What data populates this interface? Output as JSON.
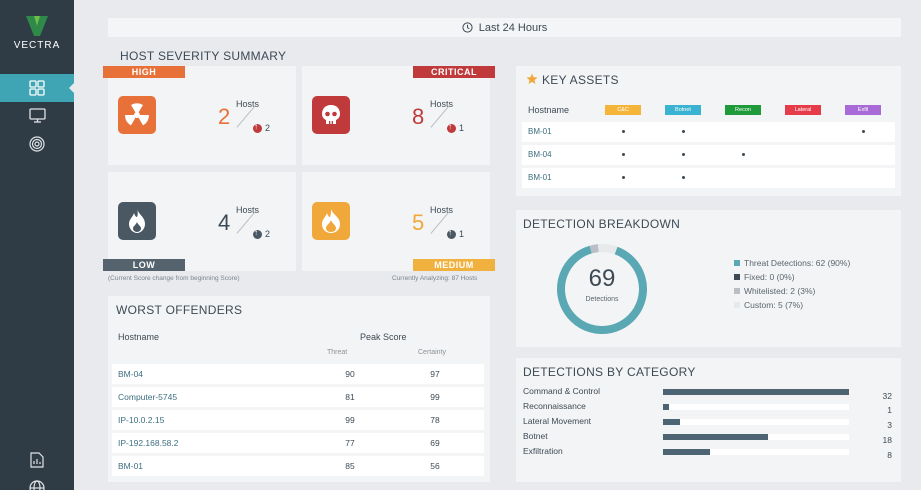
{
  "brand": {
    "name": "VECTRA"
  },
  "sidebar": {
    "items": [
      {
        "icon": "dashboard-grid-icon",
        "active": true
      },
      {
        "icon": "monitor-icon",
        "active": false
      },
      {
        "icon": "target-icon",
        "active": false
      }
    ],
    "bottom": [
      {
        "icon": "report-icon"
      },
      {
        "icon": "globe-icon"
      }
    ]
  },
  "timebar": {
    "label": "Last 24 Hours",
    "icon": "clock-icon"
  },
  "host_severity": {
    "title": "HOST SEVERITY SUMMARY",
    "cards": {
      "high": {
        "label": "HIGH",
        "count": "2",
        "hosts": "Hosts",
        "change": "2",
        "color": "#e8713a",
        "ribbon": "#e8713a",
        "icon": "radiation-icon"
      },
      "critical": {
        "label": "CRITICAL",
        "count": "8",
        "hosts": "Hosts",
        "change": "1",
        "color": "#c0393b",
        "ribbon": "#c0393b",
        "icon": "skull-icon"
      },
      "low": {
        "label": "LOW",
        "count": "4",
        "hosts": "Hosts",
        "change": "2",
        "color": "#3d4a55",
        "ribbon": "#55636e",
        "icon": "flame-icon"
      },
      "medium": {
        "label": "MEDIUM",
        "count": "5",
        "hosts": "Hosts",
        "change": "1",
        "color": "#f0a83a",
        "ribbon": "#f0b13f",
        "icon": "fire-icon"
      }
    },
    "note_left": "(Current Score change from beginning Score)",
    "note_right": "Currently Analyzing: 87 Hosts"
  },
  "worst_offenders": {
    "title": "WORST OFFENDERS",
    "col_hostname": "Hostname",
    "col_peak": "Peak Score",
    "col_threat": "Threat",
    "col_certainty": "Certainty",
    "rows": [
      {
        "host": "BM-04",
        "threat": "90",
        "certainty": "97"
      },
      {
        "host": "Computer-5745",
        "threat": "81",
        "certainty": "99"
      },
      {
        "host": "IP-10.0.2.15",
        "threat": "99",
        "certainty": "78"
      },
      {
        "host": "IP-192.168.58.2",
        "threat": "77",
        "certainty": "69"
      },
      {
        "host": "BM-01",
        "threat": "85",
        "certainty": "56"
      }
    ]
  },
  "key_assets": {
    "title": "KEY ASSETS",
    "icon": "star-icon",
    "col_hostname": "Hostname",
    "tags": [
      {
        "label": "C&C",
        "color": "#f5b53a"
      },
      {
        "label": "Botnet",
        "color": "#39b3d1"
      },
      {
        "label": "Recon",
        "color": "#1f9a3a"
      },
      {
        "label": "Lateral",
        "color": "#e63c4a"
      },
      {
        "label": "Exfil",
        "color": "#a86ad6"
      }
    ],
    "rows": [
      {
        "host": "BM-01",
        "marks": [
          true,
          true,
          false,
          false,
          true
        ]
      },
      {
        "host": "BM-04",
        "marks": [
          true,
          true,
          true,
          false,
          false
        ]
      },
      {
        "host": "BM-01",
        "marks": [
          true,
          true,
          false,
          false,
          false
        ]
      }
    ]
  },
  "detection_breakdown": {
    "title": "DETECTION BREAKDOWN",
    "total": "69",
    "total_label": "Detections",
    "legend": [
      {
        "label": "Threat Detections: 62 (90%)",
        "color": "#5aa8b3",
        "fraction": 0.9
      },
      {
        "label": "Fixed: 0 (0%)",
        "color": "#3d4a55",
        "fraction": 0.0
      },
      {
        "label": "Whitelisted: 2 (3%)",
        "color": "#b9bfc4",
        "fraction": 0.03
      },
      {
        "label": "Custom: 5 (7%)",
        "color": "#e7e9eb",
        "fraction": 0.07
      }
    ]
  },
  "detections_by_category": {
    "title": "DETECTIONS BY CATEGORY",
    "max": 32,
    "items": [
      {
        "label": "Command & Control",
        "value": "32"
      },
      {
        "label": "Reconnaissance",
        "value": "1"
      },
      {
        "label": "Lateral Movement",
        "value": "3"
      },
      {
        "label": "Botnet",
        "value": "18"
      },
      {
        "label": "Exfiltration",
        "value": "8"
      }
    ]
  }
}
